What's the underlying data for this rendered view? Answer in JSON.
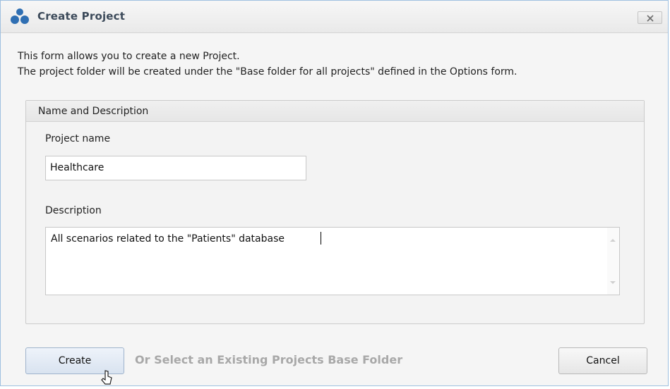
{
  "window": {
    "title": "Create Project",
    "app_icon": "app-logo-icon",
    "close_icon": "close-icon",
    "close_label": "x"
  },
  "intro": {
    "line1": "This form allows you to create a new Project.",
    "line2": "The project folder will be created under the \"Base folder for all projects\" defined in the Options form."
  },
  "group": {
    "title": "Name and Description",
    "project_name_label": "Project name",
    "project_name_value": "Healthcare",
    "description_label": "Description",
    "description_value": "All scenarios related to the \"Patients\" database"
  },
  "footer": {
    "create_label": "Create",
    "or_select_label": "Or Select an Existing Projects Base Folder",
    "cancel_label": "Cancel"
  },
  "colors": {
    "title_text": "#3c4a5a",
    "accent_blue": "#2f6fb3",
    "disabled_text": "#a8a8a8"
  }
}
